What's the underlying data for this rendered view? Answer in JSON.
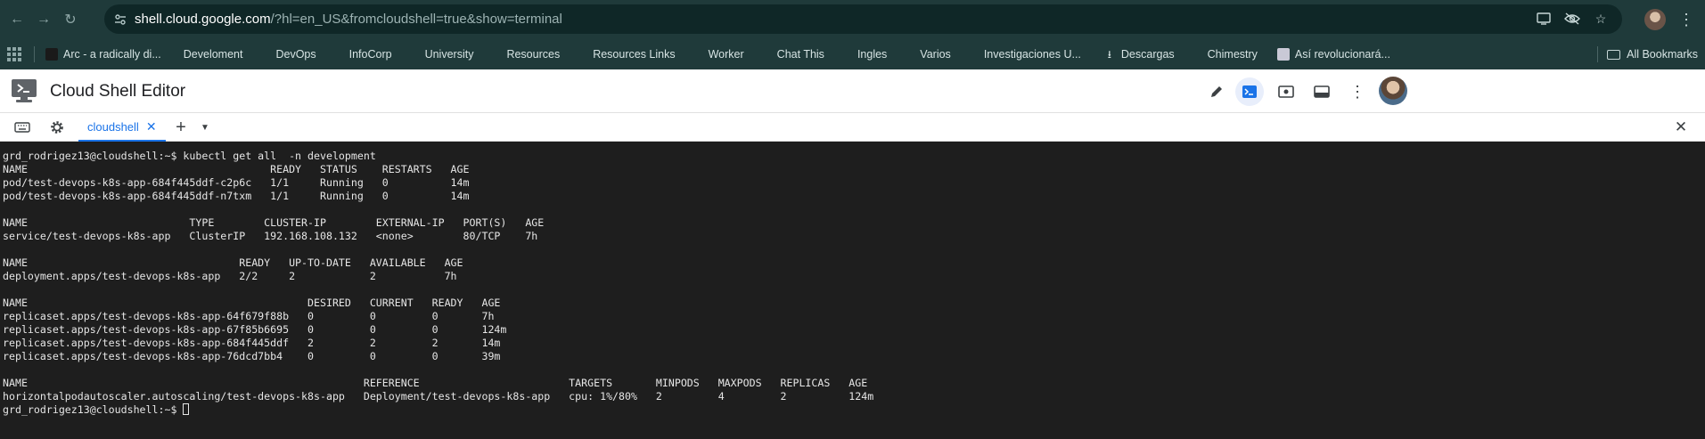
{
  "browser": {
    "url_domain": "shell.cloud.google.com",
    "url_rest": "/?hl=en_US&fromcloudshell=true&show=terminal"
  },
  "bookmarks": [
    {
      "label": "Arc - a radically di...",
      "kind": "site",
      "color": "#1a1a1a"
    },
    {
      "label": "Develoment",
      "kind": "folder"
    },
    {
      "label": "DevOps",
      "kind": "folder"
    },
    {
      "label": "InfoCorp",
      "kind": "folder"
    },
    {
      "label": "University",
      "kind": "folder"
    },
    {
      "label": "Resources",
      "kind": "folder"
    },
    {
      "label": "Resources Links",
      "kind": "folder"
    },
    {
      "label": "Worker",
      "kind": "folder"
    },
    {
      "label": "Chat This",
      "kind": "folder"
    },
    {
      "label": "Ingles",
      "kind": "folder"
    },
    {
      "label": "Varios",
      "kind": "folder"
    },
    {
      "label": "Investigaciones U...",
      "kind": "folder"
    },
    {
      "label": "Descargas",
      "kind": "download"
    },
    {
      "label": "Chimestry",
      "kind": "folder"
    },
    {
      "label": "Así revolucionará...",
      "kind": "site",
      "color": "#c9c9d6"
    }
  ],
  "bookmarks_all_label": "All Bookmarks",
  "editor": {
    "title": "Cloud Shell Editor",
    "accent_color": "#1a73e8"
  },
  "tabs": {
    "active_label": "cloudshell"
  },
  "terminal": {
    "lines": [
      "grd_rodrigez13@cloudshell:~$ kubectl get all  -n development",
      "NAME                                       READY   STATUS    RESTARTS   AGE",
      "pod/test-devops-k8s-app-684f445ddf-c2p6c   1/1     Running   0          14m",
      "pod/test-devops-k8s-app-684f445ddf-n7txm   1/1     Running   0          14m",
      "",
      "NAME                          TYPE        CLUSTER-IP        EXTERNAL-IP   PORT(S)   AGE",
      "service/test-devops-k8s-app   ClusterIP   192.168.108.132   <none>        80/TCP    7h",
      "",
      "NAME                                  READY   UP-TO-DATE   AVAILABLE   AGE",
      "deployment.apps/test-devops-k8s-app   2/2     2            2           7h",
      "",
      "NAME                                             DESIRED   CURRENT   READY   AGE",
      "replicaset.apps/test-devops-k8s-app-64f679f88b   0         0         0       7h",
      "replicaset.apps/test-devops-k8s-app-67f85b6695   0         0         0       124m",
      "replicaset.apps/test-devops-k8s-app-684f445ddf   2         2         2       14m",
      "replicaset.apps/test-devops-k8s-app-76dcd7bb4    0         0         0       39m",
      "",
      "NAME                                                      REFERENCE                        TARGETS       MINPODS   MAXPODS   REPLICAS   AGE",
      "horizontalpodautoscaler.autoscaling/test-devops-k8s-app   Deployment/test-devops-k8s-app   cpu: 1%/80%   2         4         2          124m"
    ],
    "prompt": "grd_rodrigez13@cloudshell:~$ "
  }
}
